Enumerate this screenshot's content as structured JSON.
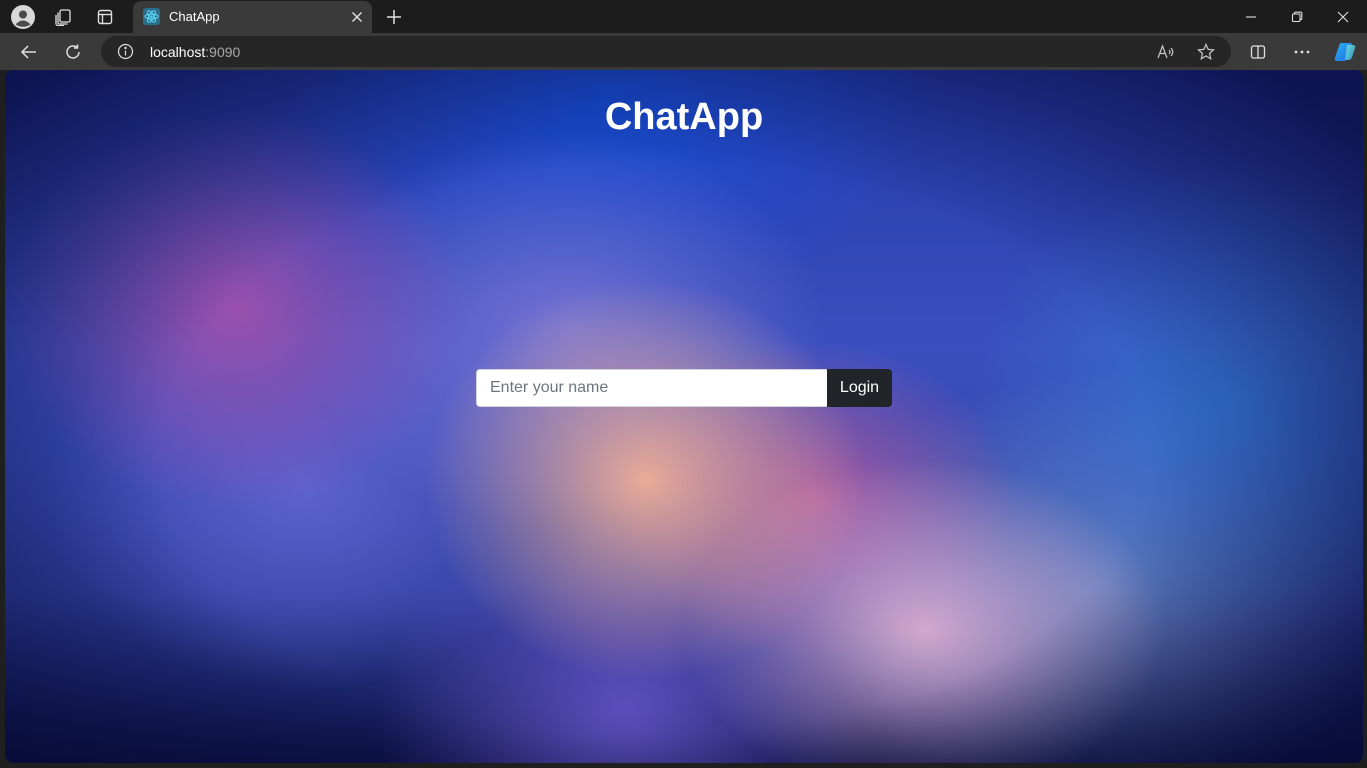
{
  "browser": {
    "tab": {
      "title": "ChatApp"
    },
    "address": {
      "host": "localhost",
      "port": ":9090"
    }
  },
  "page": {
    "title": "ChatApp",
    "login": {
      "input_value": "",
      "input_placeholder": "Enter your name",
      "button_label": "Login"
    }
  },
  "icons": {
    "profile": "profile-icon",
    "workspaces": "workspaces-icon",
    "tab_actions": "tab-actions-icon",
    "favicon": "react-icon",
    "close": "close-icon",
    "new_tab": "plus-icon",
    "back": "back-arrow-icon",
    "refresh": "refresh-icon",
    "site_info": "info-icon",
    "read_aloud": "read-aloud-icon",
    "favorite": "star-icon",
    "split": "split-screen-icon",
    "more": "more-icon",
    "copilot": "copilot-icon"
  },
  "colors": {
    "chrome_dark": "#1c1c1c",
    "toolbar": "#3a3a3a",
    "login_button": "#212529",
    "favicon": "#61dafb"
  }
}
